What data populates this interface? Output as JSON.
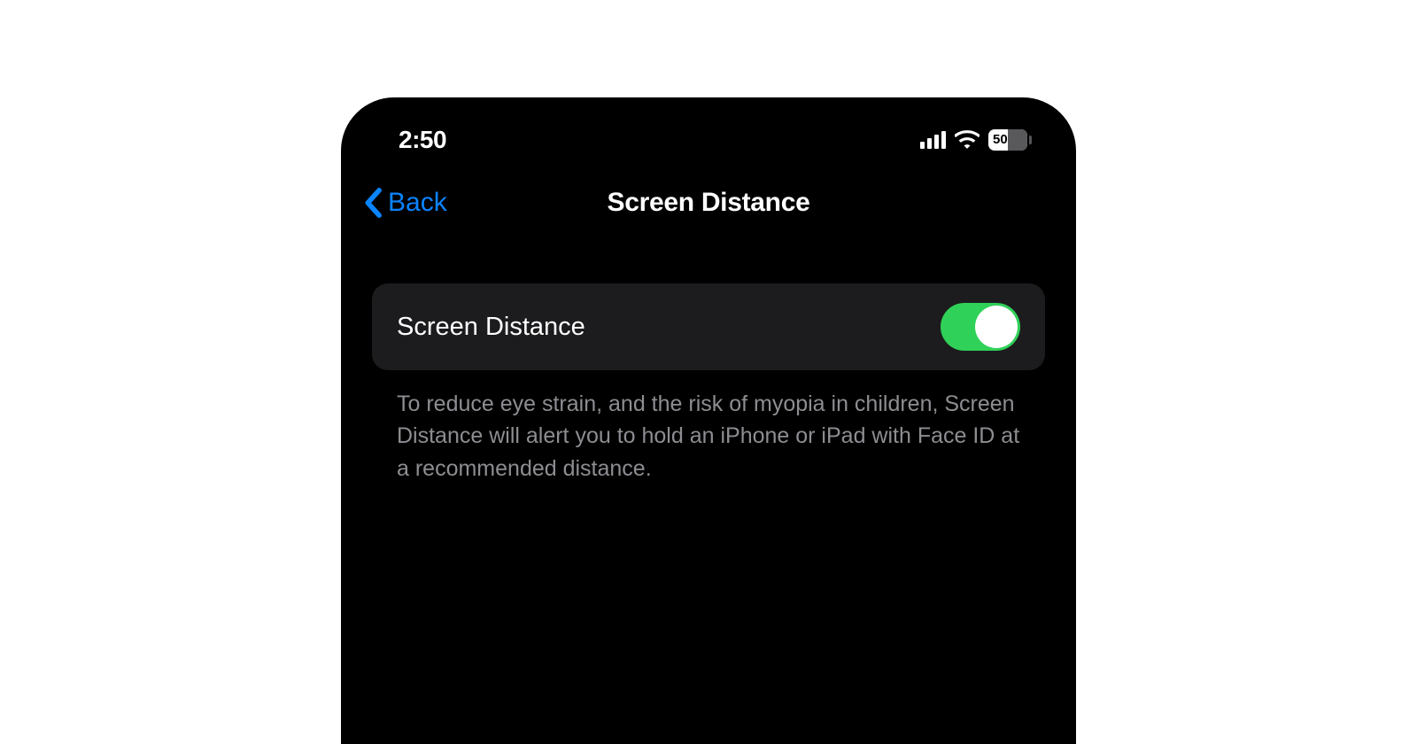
{
  "statusBar": {
    "time": "2:50",
    "batteryLevel": "50"
  },
  "navBar": {
    "backLabel": "Back",
    "title": "Screen Distance"
  },
  "setting": {
    "label": "Screen Distance",
    "enabled": true,
    "description": "To reduce eye strain, and the risk of myopia in children, Screen Distance will alert you to hold an iPhone or iPad with Face ID at a recommended distance."
  }
}
